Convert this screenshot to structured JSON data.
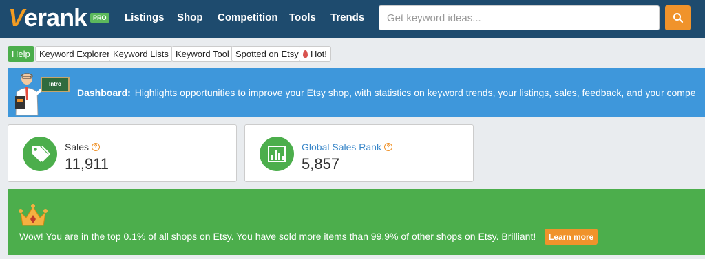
{
  "brand": {
    "name": "erank",
    "first_letter": "V",
    "badge": "PRO"
  },
  "nav": {
    "items": [
      {
        "label": "Listings"
      },
      {
        "label": "Shop"
      },
      {
        "label": "Competition"
      },
      {
        "label": "Tools"
      },
      {
        "label": "Trends"
      }
    ],
    "search": {
      "placeholder": "Get keyword ideas...",
      "value": ""
    },
    "search_icon": "search-icon"
  },
  "subnav": {
    "items": [
      {
        "label": "Help"
      },
      {
        "label": "Keyword Explorer"
      },
      {
        "label": "Keyword Lists"
      },
      {
        "label": "Keyword Tool"
      },
      {
        "label": "Spotted on Etsy"
      },
      {
        "label": "Hot!",
        "icon": "flame-icon"
      }
    ]
  },
  "dashboard": {
    "board_label": "Intro",
    "title": "Dashboard:",
    "text": "Highlights opportunities to improve your Etsy shop, with statistics on keyword trends, your listings, sales, feedback, and your compe"
  },
  "stats": {
    "sales": {
      "label": "Sales",
      "value": "11,911",
      "icon": "tag-icon",
      "help": "?"
    },
    "rank": {
      "label": "Global Sales Rank",
      "value": "5,857",
      "icon": "bar-chart-icon",
      "help": "?"
    }
  },
  "achievement": {
    "icon": "crown-icon",
    "text": "Wow! You are in the top 0.1% of all shops on Etsy. You have sold more items than 99.9% of other shops on Etsy. Brilliant!",
    "button": "Learn more"
  },
  "colors": {
    "nav_bg": "#1e4b6e",
    "accent_orange": "#f0932b",
    "green": "#4cae4c",
    "blue_banner": "#3e97db",
    "link_blue": "#3a87c9"
  }
}
